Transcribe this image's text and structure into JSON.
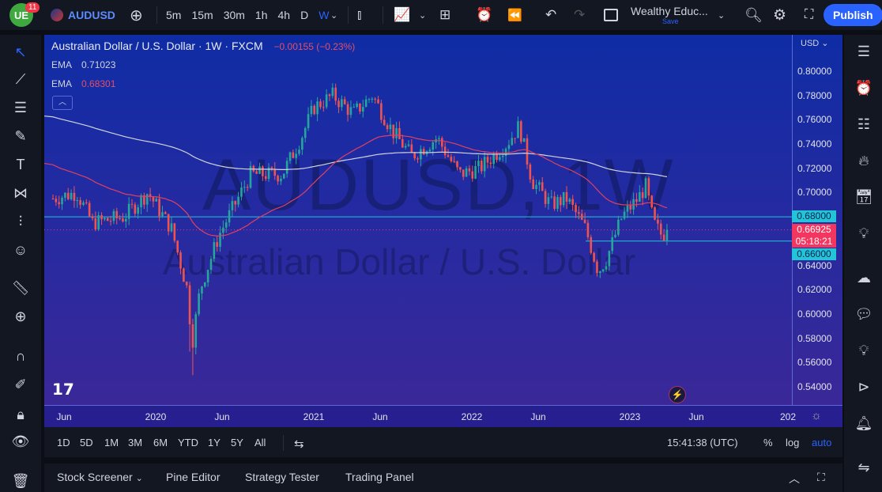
{
  "topbar": {
    "badge": "11",
    "symbol": "AUDUSD",
    "intervals": [
      "5m",
      "15m",
      "30m",
      "1h",
      "4h",
      "D",
      "W"
    ],
    "active_interval": "W",
    "layout_name": "Wealthy Educ...",
    "layout_sub": "Save",
    "publish": "Publish"
  },
  "legend": {
    "title": "Australian Dollar / U.S. Dollar · 1W · FXCM",
    "change": "−0.00155 (−0.23%)",
    "ema1_label": "EMA",
    "ema1_value": "0.71023",
    "ema2_label": "EMA",
    "ema2_value": "0.68301"
  },
  "watermark": {
    "line1": "AUDUSD, 1W",
    "line2": "Australian Dollar / U.S. Dollar"
  },
  "price_axis": {
    "currency": "USD",
    "ticks": [
      "0.80000",
      "0.78000",
      "0.76000",
      "0.74000",
      "0.72000",
      "0.70000",
      "0.64000",
      "0.62000",
      "0.60000",
      "0.58000",
      "0.56000",
      "0.54000"
    ],
    "tag_upper": "0.68000",
    "tag_price": "0.66925",
    "tag_timer": "05:18:21",
    "tag_lower": "0.66000"
  },
  "time_axis": {
    "ticks": [
      "Jun",
      "2020",
      "Jun",
      "2021",
      "Jun",
      "2022",
      "Jun",
      "2023",
      "Jun",
      "202"
    ]
  },
  "rangebar": {
    "ranges": [
      "1D",
      "5D",
      "1M",
      "3M",
      "6M",
      "YTD",
      "1Y",
      "5Y",
      "All"
    ],
    "clock": "15:41:38 (UTC)",
    "percent": "%",
    "log": "log",
    "auto": "auto"
  },
  "bottom_tabs": [
    "Stock Screener",
    "Pine Editor",
    "Strategy Tester",
    "Trading Panel"
  ],
  "colors": {
    "up": "#26a69a",
    "down": "#ef5350",
    "ema_long": "#d1d4dc",
    "ema_short": "#e04060",
    "cyan": "#22c5d8",
    "accent": "#2962ff"
  },
  "chart_data": {
    "type": "candlestick",
    "symbol": "AUDUSD",
    "interval": "1W",
    "ylim": [
      0.53,
      0.815
    ],
    "anchors": [
      [
        2019.35,
        0.695
      ],
      [
        2019.5,
        0.7
      ],
      [
        2019.6,
        0.675
      ],
      [
        2019.8,
        0.68
      ],
      [
        2019.95,
        0.7
      ],
      [
        2020.1,
        0.67
      ],
      [
        2020.2,
        0.62
      ],
      [
        2020.23,
        0.575
      ],
      [
        2020.28,
        0.62
      ],
      [
        2020.4,
        0.665
      ],
      [
        2020.5,
        0.69
      ],
      [
        2020.6,
        0.715
      ],
      [
        2020.8,
        0.715
      ],
      [
        2020.92,
        0.745
      ],
      [
        2021.0,
        0.77
      ],
      [
        2021.12,
        0.78
      ],
      [
        2021.25,
        0.765
      ],
      [
        2021.37,
        0.78
      ],
      [
        2021.5,
        0.75
      ],
      [
        2021.62,
        0.73
      ],
      [
        2021.78,
        0.745
      ],
      [
        2021.92,
        0.715
      ],
      [
        2022.05,
        0.72
      ],
      [
        2022.22,
        0.74
      ],
      [
        2022.3,
        0.755
      ],
      [
        2022.38,
        0.71
      ],
      [
        2022.5,
        0.69
      ],
      [
        2022.6,
        0.695
      ],
      [
        2022.72,
        0.67
      ],
      [
        2022.8,
        0.635
      ],
      [
        2022.85,
        0.645
      ],
      [
        2022.95,
        0.68
      ],
      [
        2023.05,
        0.695
      ],
      [
        2023.1,
        0.705
      ],
      [
        2023.15,
        0.675
      ],
      [
        2023.2,
        0.665
      ],
      [
        2023.25,
        0.669
      ]
    ],
    "ema_long_start": 0.763,
    "ema_short_start": 0.724,
    "hlines": [
      0.68,
      0.66
    ],
    "last": 0.66925
  }
}
